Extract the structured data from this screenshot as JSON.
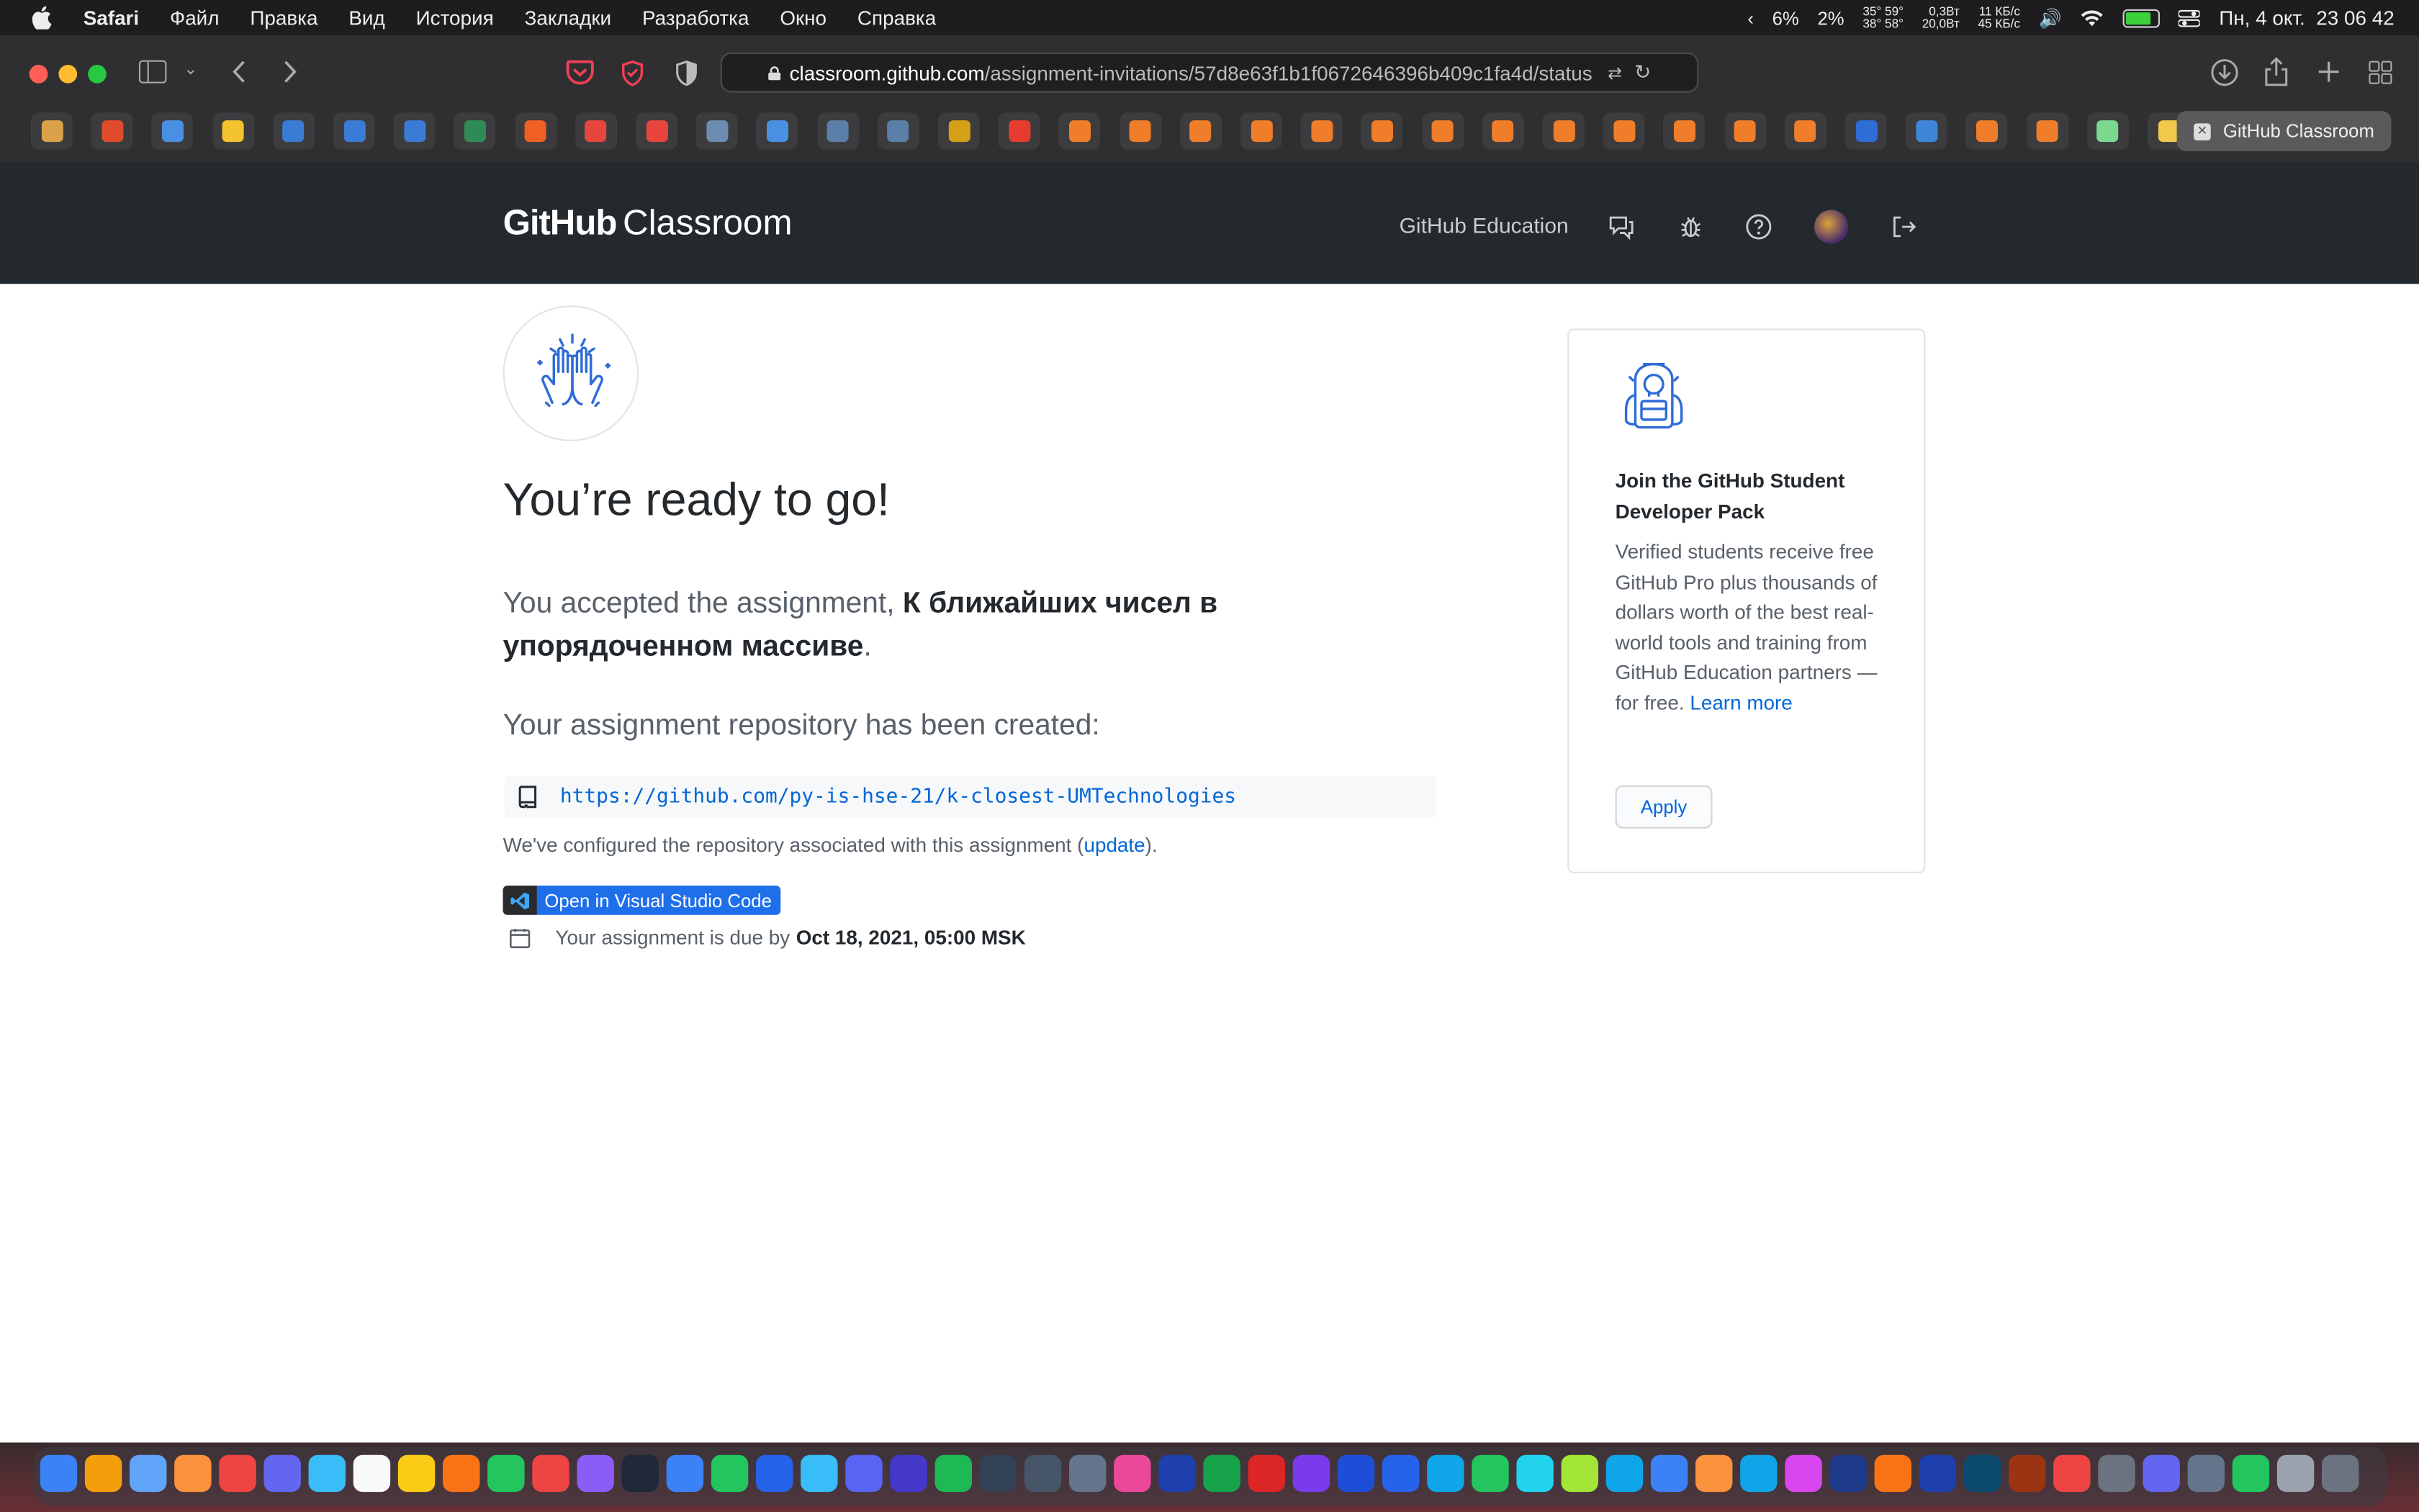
{
  "menubar": {
    "app_name": "Safari",
    "items": [
      "Файл",
      "Правка",
      "Вид",
      "История",
      "Закладки",
      "Разработка",
      "Окно",
      "Справка"
    ],
    "cpu": "6%",
    "gpu": "2%",
    "temps": "35° 59°\n38° 58°",
    "power": "0,3Вт\n20,0Вт",
    "network": "11 КБ/с\n45 КБ/с",
    "clock": "Пн, 4 окт.  23 06 42",
    "battery_level": 0.85
  },
  "browser": {
    "url_domain": "classroom.github.com",
    "url_path": "/assignment-invitations/57d8e63f1b1f0672646396b409c1fa4d/status",
    "active_tab_label": "GitHub Classroom",
    "bookmark_colors": [
      "#d9a24a",
      "#e14b2b",
      "#4a90e2",
      "#f4c430",
      "#3a7bd5",
      "#3a7bd5",
      "#3a7bd5",
      "#2e8b57",
      "#f25f23",
      "#e8453c",
      "#e8453c",
      "#6b8cae",
      "#4a90e2",
      "#5a7fa8",
      "#5a7fa8",
      "#d4a017",
      "#e63c2f",
      "#f07d2a",
      "#f07d2a",
      "#f07d2a",
      "#f07d2a",
      "#f07d2a",
      "#f07d2a",
      "#f07d2a",
      "#f07d2a",
      "#f07d2a",
      "#f07d2a",
      "#f07d2a",
      "#f07d2a",
      "#f07d2a",
      "#2f6cd6",
      "#3f86d8",
      "#f07d2a",
      "#f07d2a",
      "#7bd88f",
      "#f2c94c"
    ]
  },
  "header": {
    "logo_bold": "GitHub",
    "logo_light": "Classroom",
    "nav_education": "GitHub Education"
  },
  "main": {
    "title": "You’re ready to go!",
    "accepted_prefix": "You accepted the assignment, ",
    "assignment_name": "К ближайших чисел в упорядоченном массиве",
    "accepted_suffix": ".",
    "repo_created": "Your assignment repository has been created:",
    "repo_url": "https://github.com/py-is-hse-21/k-closest-UMTechnologies",
    "configured_prefix": "We've configured the repository associated with this assignment (",
    "configured_link": "update",
    "configured_suffix": ").",
    "vscode_button": "Open in Visual Studio Code",
    "due_prefix": "Your assignment is due by",
    "due_date": "Oct 18, 2021, 05:00 MSK"
  },
  "sidebar_card": {
    "title": "Join the GitHub Student Developer Pack",
    "description": "Verified students receive free GitHub Pro plus thousands of dollars worth of the best real-world tools and training from GitHub Education partners — for free. ",
    "learn_more": "Learn more",
    "apply_button": "Apply"
  },
  "colors": {
    "header_bg": "#24292e",
    "link": "#0366d6",
    "vscode_blue": "#1f6feb"
  },
  "dock": {
    "icon_colors": [
      "#3b82f6",
      "#f59e0b",
      "#60a5fa",
      "#fb923c",
      "#ef4444",
      "#6366f1",
      "#38bdf8",
      "#f8fafc",
      "#facc15",
      "#f97316",
      "#22c55e",
      "#ef4444",
      "#8b5cf6",
      "#1f2937",
      "#3b82f6",
      "#22c55e",
      "#2563eb",
      "#38bdf8",
      "#5865f2",
      "#4338ca",
      "#1db954",
      "#334155",
      "#475569",
      "#64748b",
      "#ec4899",
      "#1e40af",
      "#16a34a",
      "#dc2626",
      "#7c3aed",
      "#1d4ed8",
      "#2563eb",
      "#0ea5e9",
      "#22c55e",
      "#22d3ee",
      "#a3e635",
      "#0ea5e9",
      "#3b82f6",
      "#fb923c",
      "#0ea5e9",
      "#d946ef",
      "#1e3a8a",
      "#f97316",
      "#1e40af",
      "#0c4a6e",
      "#9a3412",
      "#ef4444",
      "#6b7280",
      "#6366f1",
      "#64748b",
      "#22c55e",
      "#9ca3af",
      "#6b7280"
    ]
  }
}
